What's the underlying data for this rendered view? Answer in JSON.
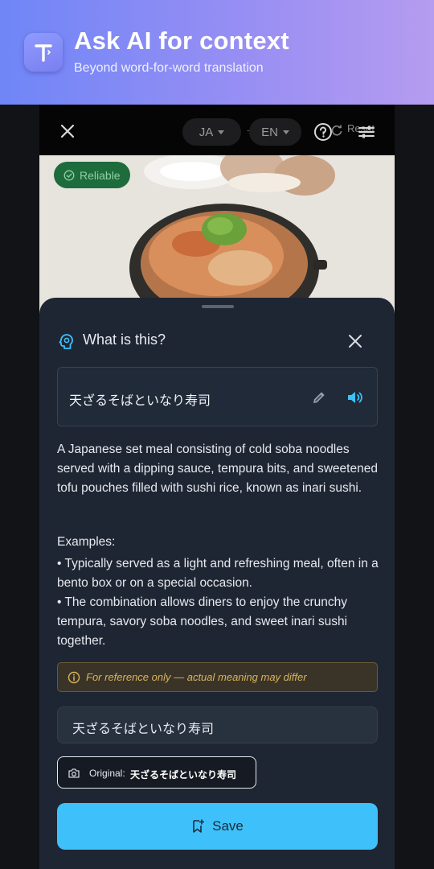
{
  "promo": {
    "title": "Ask AI for context",
    "subtitle": "Beyond word-for-word translation",
    "icon": "translate-t-icon"
  },
  "topbar": {
    "source_lang": "JA",
    "target_lang": "EN",
    "arrow": "→",
    "reset_label": "Reset",
    "icons": [
      "close-icon",
      "help-icon",
      "reset-icon",
      "tune-icon"
    ]
  },
  "photo": {
    "badge": "Reliable",
    "badge_icon": "check-circle-icon"
  },
  "sheet": {
    "title": "What is this?",
    "term": "天ざるそばといなり寿司",
    "description": "A Japanese set meal consisting of cold soba noodles served with a dipping sauce, tempura bits, and sweetened tofu pouches filled with sushi rice, known as inari sushi.",
    "examples_title": "Examples:",
    "examples": [
      "• Typically served as a light and refreshing meal, often in a bento box or on a special occasion.",
      "• The combination allows diners to enjoy the crunchy tempura, savory soba noodles, and sweet inari sushi together."
    ],
    "note": "For reference only — actual meaning may differ",
    "answer": "天ざるそばといなり寿司",
    "original_label": "Original:",
    "original_value": "天ざるそばといなり寿司",
    "save_label": "Save"
  },
  "colors": {
    "accent": "#3ec1fb",
    "sheet_bg": "#1f2633",
    "reliable_bg": "#1e6b3c",
    "note_text": "#d9b45d"
  }
}
